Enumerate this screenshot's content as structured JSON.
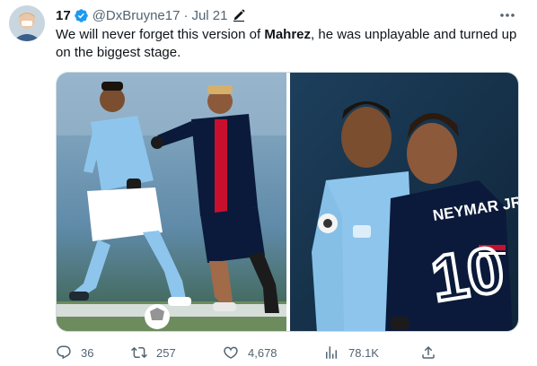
{
  "tweet": {
    "display_name": "17",
    "handle": "@DxBruyne17",
    "separator": "·",
    "date": "Jul 21",
    "text_before": "We will never forget this version of ",
    "text_bold": "Mahrez",
    "text_after": ", he was unplayable and turned up on the biggest stage.",
    "jersey_text": "NEYMAR JR",
    "jersey_number": "10"
  },
  "actions": {
    "replies": "36",
    "retweets": "257",
    "likes": "4,678",
    "views": "78.1K"
  },
  "icons": {
    "verified": "verified-badge-icon",
    "edit": "edited-pencil-icon",
    "more": "more-dots-icon",
    "reply": "reply-icon",
    "retweet": "retweet-icon",
    "like": "heart-icon",
    "views": "views-chart-icon",
    "share": "share-icon"
  },
  "colors": {
    "text": "#0f1419",
    "secondary": "#536471",
    "verified_blue": "#1d9bf0",
    "city_blue": "#6cabdd",
    "psg_navy": "#0b1a3a",
    "psg_red": "#c8102e"
  }
}
